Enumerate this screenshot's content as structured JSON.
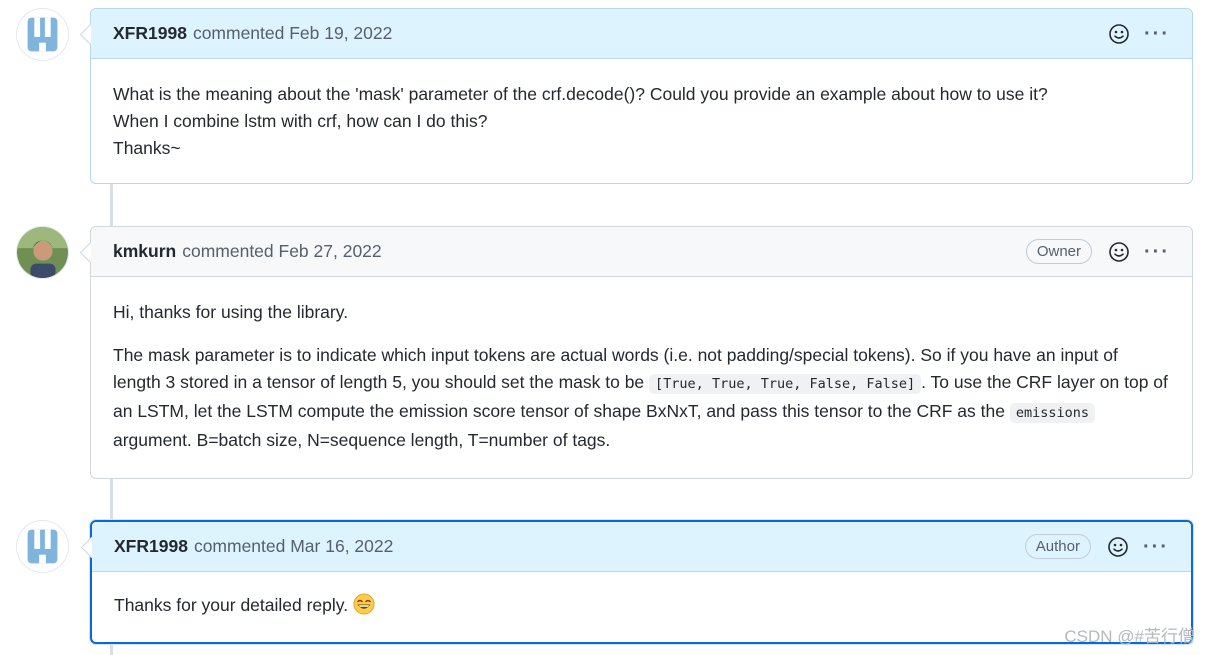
{
  "comments": [
    {
      "author": "XFR1998",
      "meta": "commented Feb 19, 2022",
      "role": "",
      "body_lines": [
        "What is the meaning about the 'mask' parameter of the crf.decode()? Could you provide an example about how to use it?",
        "When I combine lstm with crf, how can I do this?",
        "Thanks~"
      ]
    },
    {
      "author": "kmkurn",
      "meta": "commented Feb 27, 2022",
      "role": "Owner",
      "p1": "Hi, thanks for using the library.",
      "p2_a": "The mask parameter is to indicate which input tokens are actual words (i.e. not padding/special tokens). So if you have an input of length 3 stored in a tensor of length 5, you should set the mask to be ",
      "p2_code1": "[True, True, True, False, False]",
      "p2_b": ". To use the CRF layer on top of an LSTM, let the LSTM compute the emission score tensor of shape BxNxT, and pass this tensor to the CRF as the ",
      "p2_code2": "emissions",
      "p2_c": " argument. B=batch size, N=sequence length, T=number of tags."
    },
    {
      "author": "XFR1998",
      "meta": "commented Mar 16, 2022",
      "role": "Author",
      "body": "Thanks for your detailed reply."
    }
  ],
  "icons": {
    "reaction": "smiley-icon",
    "menu": "kebab-icon",
    "emoji": "grinning-face-emoji"
  },
  "watermark": "CSDN @#苦行僧",
  "colors": {
    "header_blue": "#ddf4ff",
    "header_gray": "#f6f8fa",
    "highlight_border": "#0969da"
  }
}
